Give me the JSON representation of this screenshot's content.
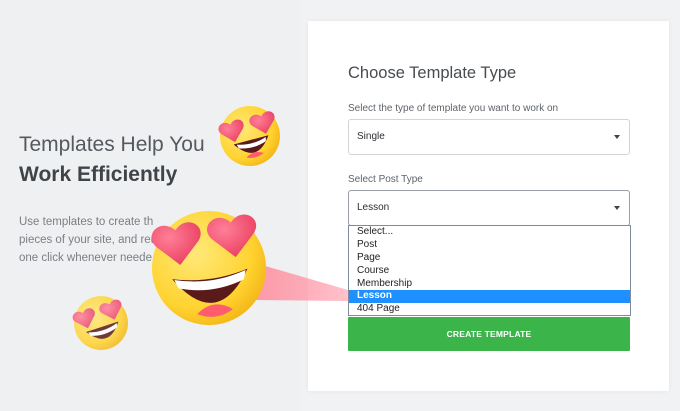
{
  "left": {
    "heading_line1": "Templates Help You",
    "heading_line2": "Work Efficiently",
    "text_lines": [
      "Use templates to create th",
      "pieces of your site, and reu",
      "one click whenever neede"
    ]
  },
  "card": {
    "title": "Choose Template Type",
    "type_label": "Select the type of template you want to work on",
    "type_value": "Single",
    "post_label": "Select Post Type",
    "post_value": "Lesson",
    "post_options": [
      "Select...",
      "Post",
      "Page",
      "Course",
      "Membership",
      "Lesson",
      "404 Page"
    ],
    "selected_option": "Lesson",
    "create_label": "CREATE TEMPLATE"
  },
  "colors": {
    "accent_green": "#3bb44a",
    "selection_blue": "#1e90ff"
  },
  "icons": [
    "heart-eyes-emoji-icon"
  ]
}
